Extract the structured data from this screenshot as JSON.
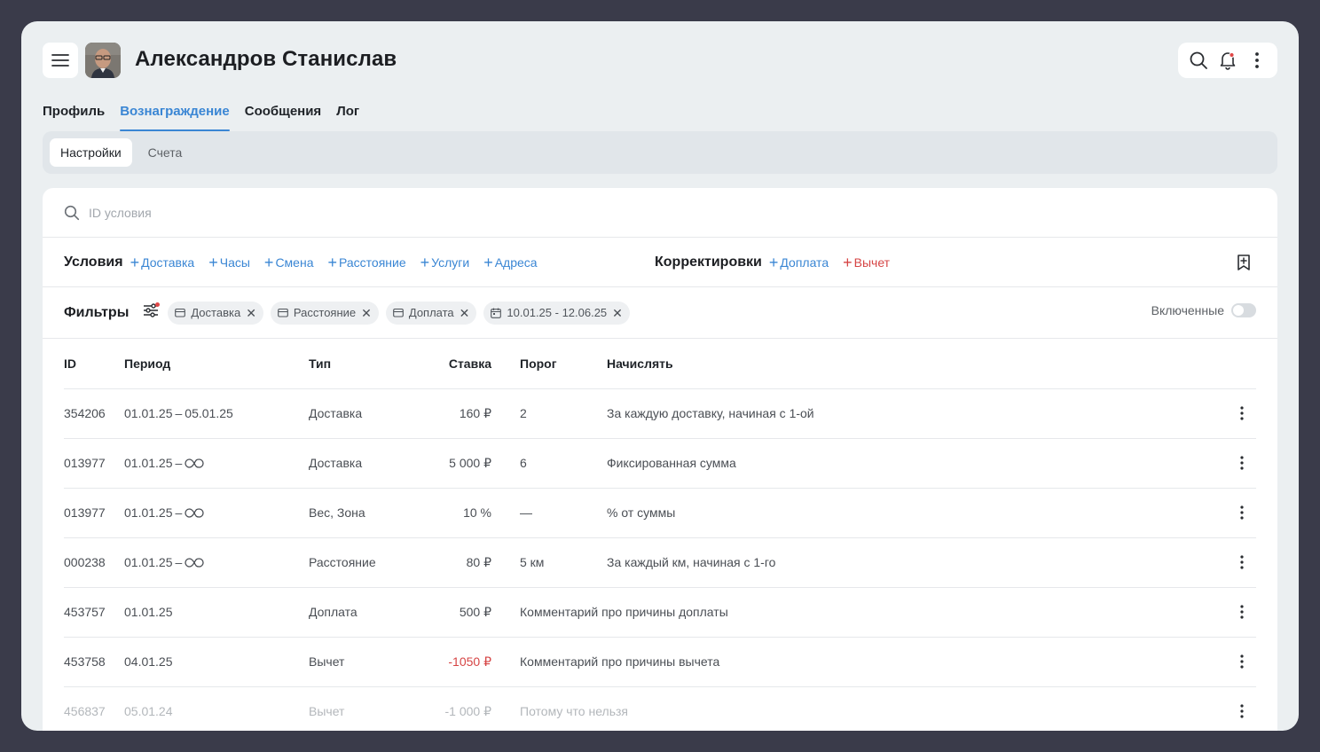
{
  "header": {
    "title": "Александров Станислав",
    "accent": "#3a86d4"
  },
  "tabs": [
    {
      "label": "Профиль",
      "active": false
    },
    {
      "label": "Вознаграждение",
      "active": true
    },
    {
      "label": "Сообщения",
      "active": false
    },
    {
      "label": "Лог",
      "active": false
    }
  ],
  "subtabs": [
    {
      "label": "Настройки",
      "active": true
    },
    {
      "label": "Счета",
      "active": false
    }
  ],
  "search": {
    "placeholder": "ID условия",
    "value": ""
  },
  "conditions": {
    "label": "Условия",
    "items": [
      "Доставка",
      "Часы",
      "Смена",
      "Расстояние",
      "Услуги",
      "Адреса"
    ]
  },
  "adjustments": {
    "label": "Корректировки",
    "items": [
      {
        "label": "Доплата",
        "color": "#3a86d4"
      },
      {
        "label": "Вычет",
        "color": "#d64545"
      }
    ]
  },
  "filters": {
    "label": "Фильтры",
    "chips": [
      "Доставка",
      "Расстояние",
      "Доплата",
      "10.01.25 - 12.06.25"
    ],
    "toggle_label": "Включенные",
    "toggle_on": false
  },
  "table": {
    "columns": [
      "ID",
      "Период",
      "Тип",
      "Ставка",
      "Порог",
      "Начислять"
    ],
    "rows": [
      {
        "id": "354206",
        "period_start": "01.01.25",
        "period_end": "05.01.25",
        "infinite": false,
        "type": "Доставка",
        "rate": "160 ₽",
        "threshold": "2",
        "accrual": "За каждую доставку, начиная с 1-ой",
        "negative": false,
        "dim": false
      },
      {
        "id": "013977",
        "period_start": "01.01.25",
        "period_end": "",
        "infinite": true,
        "type": "Доставка",
        "rate": "5 000 ₽",
        "threshold": "6",
        "accrual": "Фиксированная сумма",
        "negative": false,
        "dim": false
      },
      {
        "id": "013977",
        "period_start": "01.01.25",
        "period_end": "",
        "infinite": true,
        "type": "Вес, Зона",
        "rate": "10 %",
        "threshold": "—",
        "accrual": "% от суммы",
        "negative": false,
        "dim": false
      },
      {
        "id": "000238",
        "period_start": "01.01.25",
        "period_end": "",
        "infinite": true,
        "type": "Расстояние",
        "rate": "80 ₽",
        "threshold": "5 км",
        "accrual": "За каждый км, начиная с 1-го",
        "negative": false,
        "dim": false
      },
      {
        "id": "453757",
        "period_start": "01.01.25",
        "period_end": "",
        "infinite": false,
        "type": "Доплата",
        "rate": "500 ₽",
        "comment": "Комментарий про причины доплаты",
        "negative": false,
        "dim": false
      },
      {
        "id": "453758",
        "period_start": "04.01.25",
        "period_end": "",
        "infinite": false,
        "type": "Вычет",
        "rate": "-1050 ₽",
        "comment": "Комментарий про причины вычета",
        "negative": true,
        "dim": false
      },
      {
        "id": "456837",
        "period_start": "05.01.24",
        "period_end": "",
        "infinite": false,
        "type": "Вычет",
        "rate": "-1 000 ₽",
        "comment": "Потому что нельзя",
        "negative": true,
        "dim": true
      }
    ]
  }
}
